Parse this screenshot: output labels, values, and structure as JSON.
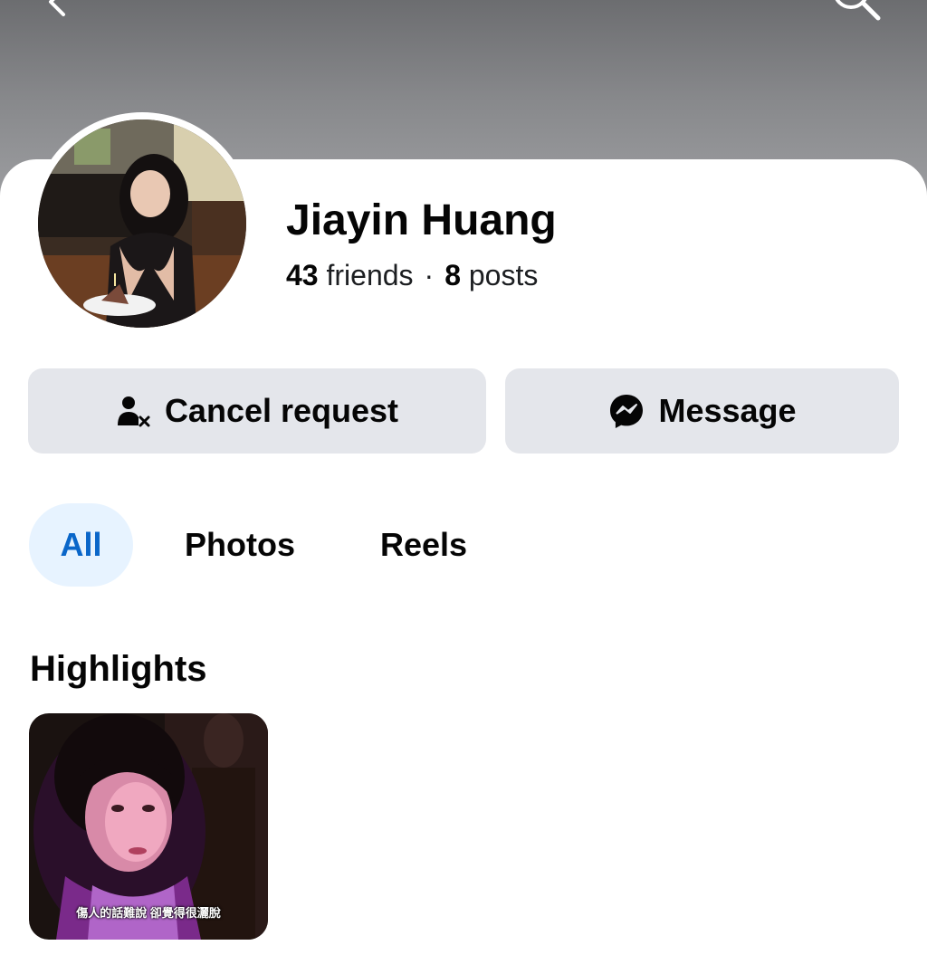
{
  "header": {
    "back_icon": "chevron-left-icon",
    "more_icon": "more-horizontal-icon",
    "search_icon": "search-icon"
  },
  "profile": {
    "name": "Jiayin Huang",
    "friends_count": "43",
    "friends_label": "friends",
    "separator": "·",
    "posts_count": "8",
    "posts_label": "posts",
    "avatar_icon": "profile-photo"
  },
  "actions": {
    "cancel_request": {
      "label": "Cancel request",
      "icon": "person-cancel-icon"
    },
    "message": {
      "label": "Message",
      "icon": "messenger-icon"
    }
  },
  "tabs": [
    {
      "label": "All",
      "active": true
    },
    {
      "label": "Photos",
      "active": false
    },
    {
      "label": "Reels",
      "active": false
    }
  ],
  "highlights": {
    "title": "Highlights",
    "items": [
      {
        "caption": "傷人的話難說 卻覺得很灑脫"
      }
    ]
  },
  "colors": {
    "active_tab_bg": "#e7f3ff",
    "active_tab_text": "#0a66c9",
    "button_bg": "#e4e6eb"
  }
}
